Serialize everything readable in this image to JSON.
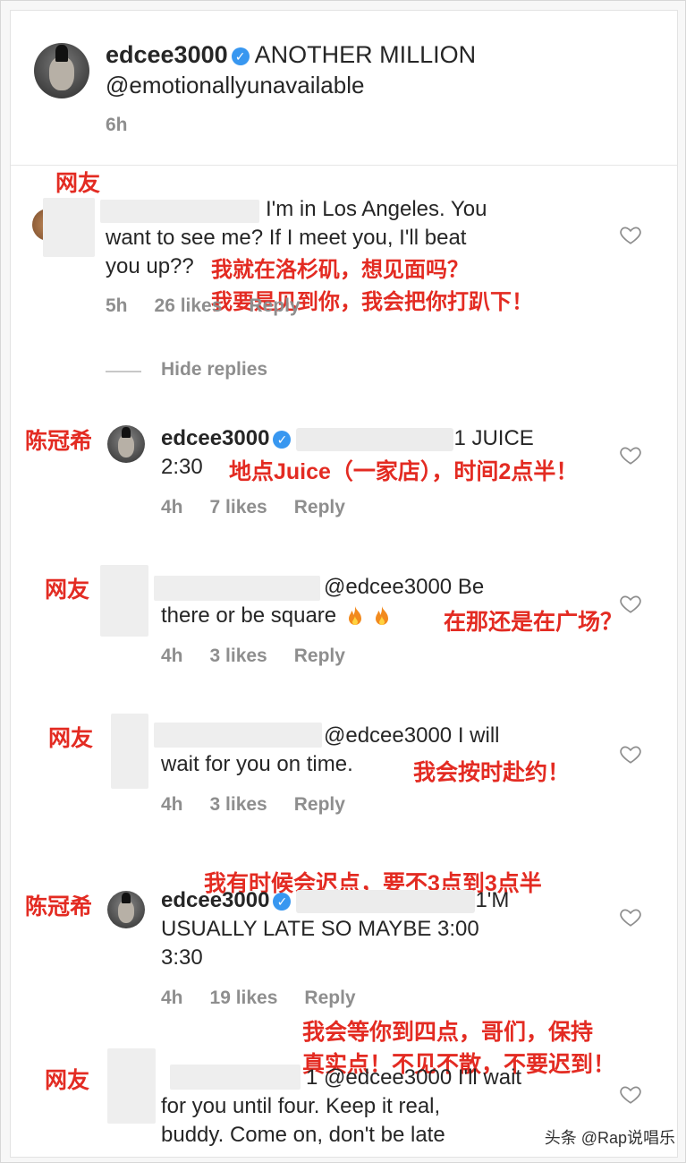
{
  "post": {
    "username": "edcee3000",
    "caption": "ANOTHER MILLION",
    "mention": "@emotionallyunavailable",
    "time": "6h"
  },
  "comments": {
    "c1": {
      "label": "网友",
      "text_line1": "I'm in Los Angeles. You",
      "text_line2": "want to see me? If I meet you, I'll beat",
      "text_line3": "you up??",
      "translation1": "我就在洛杉矶，想见面吗？",
      "translation2": "我要是见到你，我会把你打趴下！",
      "time": "5h",
      "likes": "26 likes",
      "reply": "Reply",
      "hide_replies": "Hide replies"
    },
    "c2": {
      "label": "陈冠希",
      "username": "edcee3000",
      "text_tail": "1 JUICE",
      "text_line2": "2:30",
      "translation": "地点Juice（一家店），时间2点半！",
      "time": "4h",
      "likes": "7 likes",
      "reply": "Reply"
    },
    "c3": {
      "label": "网友",
      "mention": "@edcee3000 Be",
      "text_line2": "there or be square",
      "translation": "在那还是在广场？",
      "time": "4h",
      "likes": "3 likes",
      "reply": "Reply"
    },
    "c4": {
      "label": "网友",
      "mention": "@edcee3000 I will",
      "text_line2": "wait for you on time.",
      "translation": "我会按时赴约！",
      "time": "4h",
      "likes": "3 likes",
      "reply": "Reply"
    },
    "c5": {
      "label": "陈冠希",
      "username": "edcee3000",
      "text_tail": "1'M",
      "text_line2": "USUALLY LATE SO MAYBE 3:00",
      "text_line3": "3:30",
      "translation": "我有时候会迟点，要不3点到3点半",
      "time": "4h",
      "likes": "19 likes",
      "reply": "Reply"
    },
    "c6": {
      "label": "网友",
      "mention": "1 @edcee3000 I'll wait",
      "text_line2": "for you until four. Keep it real,",
      "text_line3": "buddy. Come on, don't be late",
      "translation1": "我会等你到四点，哥们，保持",
      "translation2": "真实点！不见不散，不要迟到！"
    }
  },
  "watermark": "头条 @Rap说唱乐",
  "colors": {
    "annotation": "#e32b22",
    "verified": "#3897f0",
    "meta": "#8e8e8e",
    "text": "#262626"
  }
}
